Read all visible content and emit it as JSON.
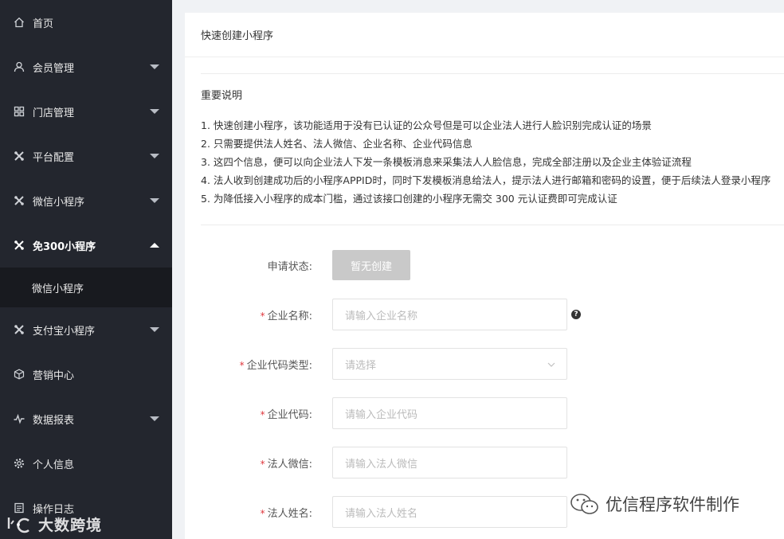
{
  "sidebar": {
    "items": [
      {
        "label": "首页",
        "icon": "home-icon",
        "caret": false
      },
      {
        "label": "会员管理",
        "icon": "user-icon",
        "caret": "down"
      },
      {
        "label": "门店管理",
        "icon": "store-grid-icon",
        "caret": "down"
      },
      {
        "label": "平台配置",
        "icon": "tools-icon",
        "caret": "down"
      },
      {
        "label": "微信小程序",
        "icon": "tools-icon",
        "caret": "down"
      },
      {
        "label": "免300小程序",
        "icon": "tools-icon",
        "caret": "up"
      },
      {
        "label": "微信小程序",
        "icon": null,
        "caret": false
      },
      {
        "label": "支付宝小程序",
        "icon": "tools-icon",
        "caret": "down"
      },
      {
        "label": "营销中心",
        "icon": "cube-icon",
        "caret": false
      },
      {
        "label": "数据报表",
        "icon": "pulse-icon",
        "caret": "down"
      },
      {
        "label": "个人信息",
        "icon": "gear-icon",
        "caret": false
      },
      {
        "label": "操作日志",
        "icon": "log-icon",
        "caret": false
      }
    ],
    "watermark": "大数跨境"
  },
  "header": {
    "title": "快速创建小程序"
  },
  "notice": {
    "title": "重要说明",
    "lines": [
      "1. 快速创建小程序，该功能适用于没有已认证的公众号但是可以企业法人进行人脸识别完成认证的场景",
      "2. 只需要提供法人姓名、法人微信、企业名称、企业代码信息",
      "3. 这四个信息，便可以向企业法人下发一条模板消息来采集法人人脸信息，完成全部注册以及企业主体验证流程",
      "4. 法人收到创建成功后的小程序APPID时，同时下发模板消息给法人，提示法人进行邮箱和密码的设置，便于后续法人登录小程序",
      "5. 为降低接入小程序的成本门槛，通过该接口创建的小程序无需交 300 元认证费即可完成认证"
    ]
  },
  "form": {
    "status_label": "申请状态:",
    "status_value": "暂无创建",
    "required_mark": "*",
    "company_name_label": "企业名称:",
    "company_name_placeholder": "请输入企业名称",
    "help_glyph": "?",
    "code_type_label": "企业代码类型:",
    "code_type_placeholder": "请选择",
    "company_code_label": "企业代码:",
    "company_code_placeholder": "请输入企业代码",
    "legal_wechat_label": "法人微信:",
    "legal_wechat_placeholder": "请输入法人微信",
    "legal_name_label": "法人姓名:",
    "legal_name_placeholder": "请输入法人姓名"
  },
  "watermark_right": "优信程序软件制作",
  "colors": {
    "sidebar_bg": "#23262e",
    "sidebar_sub_bg": "#181a1f",
    "required": "#e0383e",
    "disabled_button": "#c9c9c9"
  }
}
